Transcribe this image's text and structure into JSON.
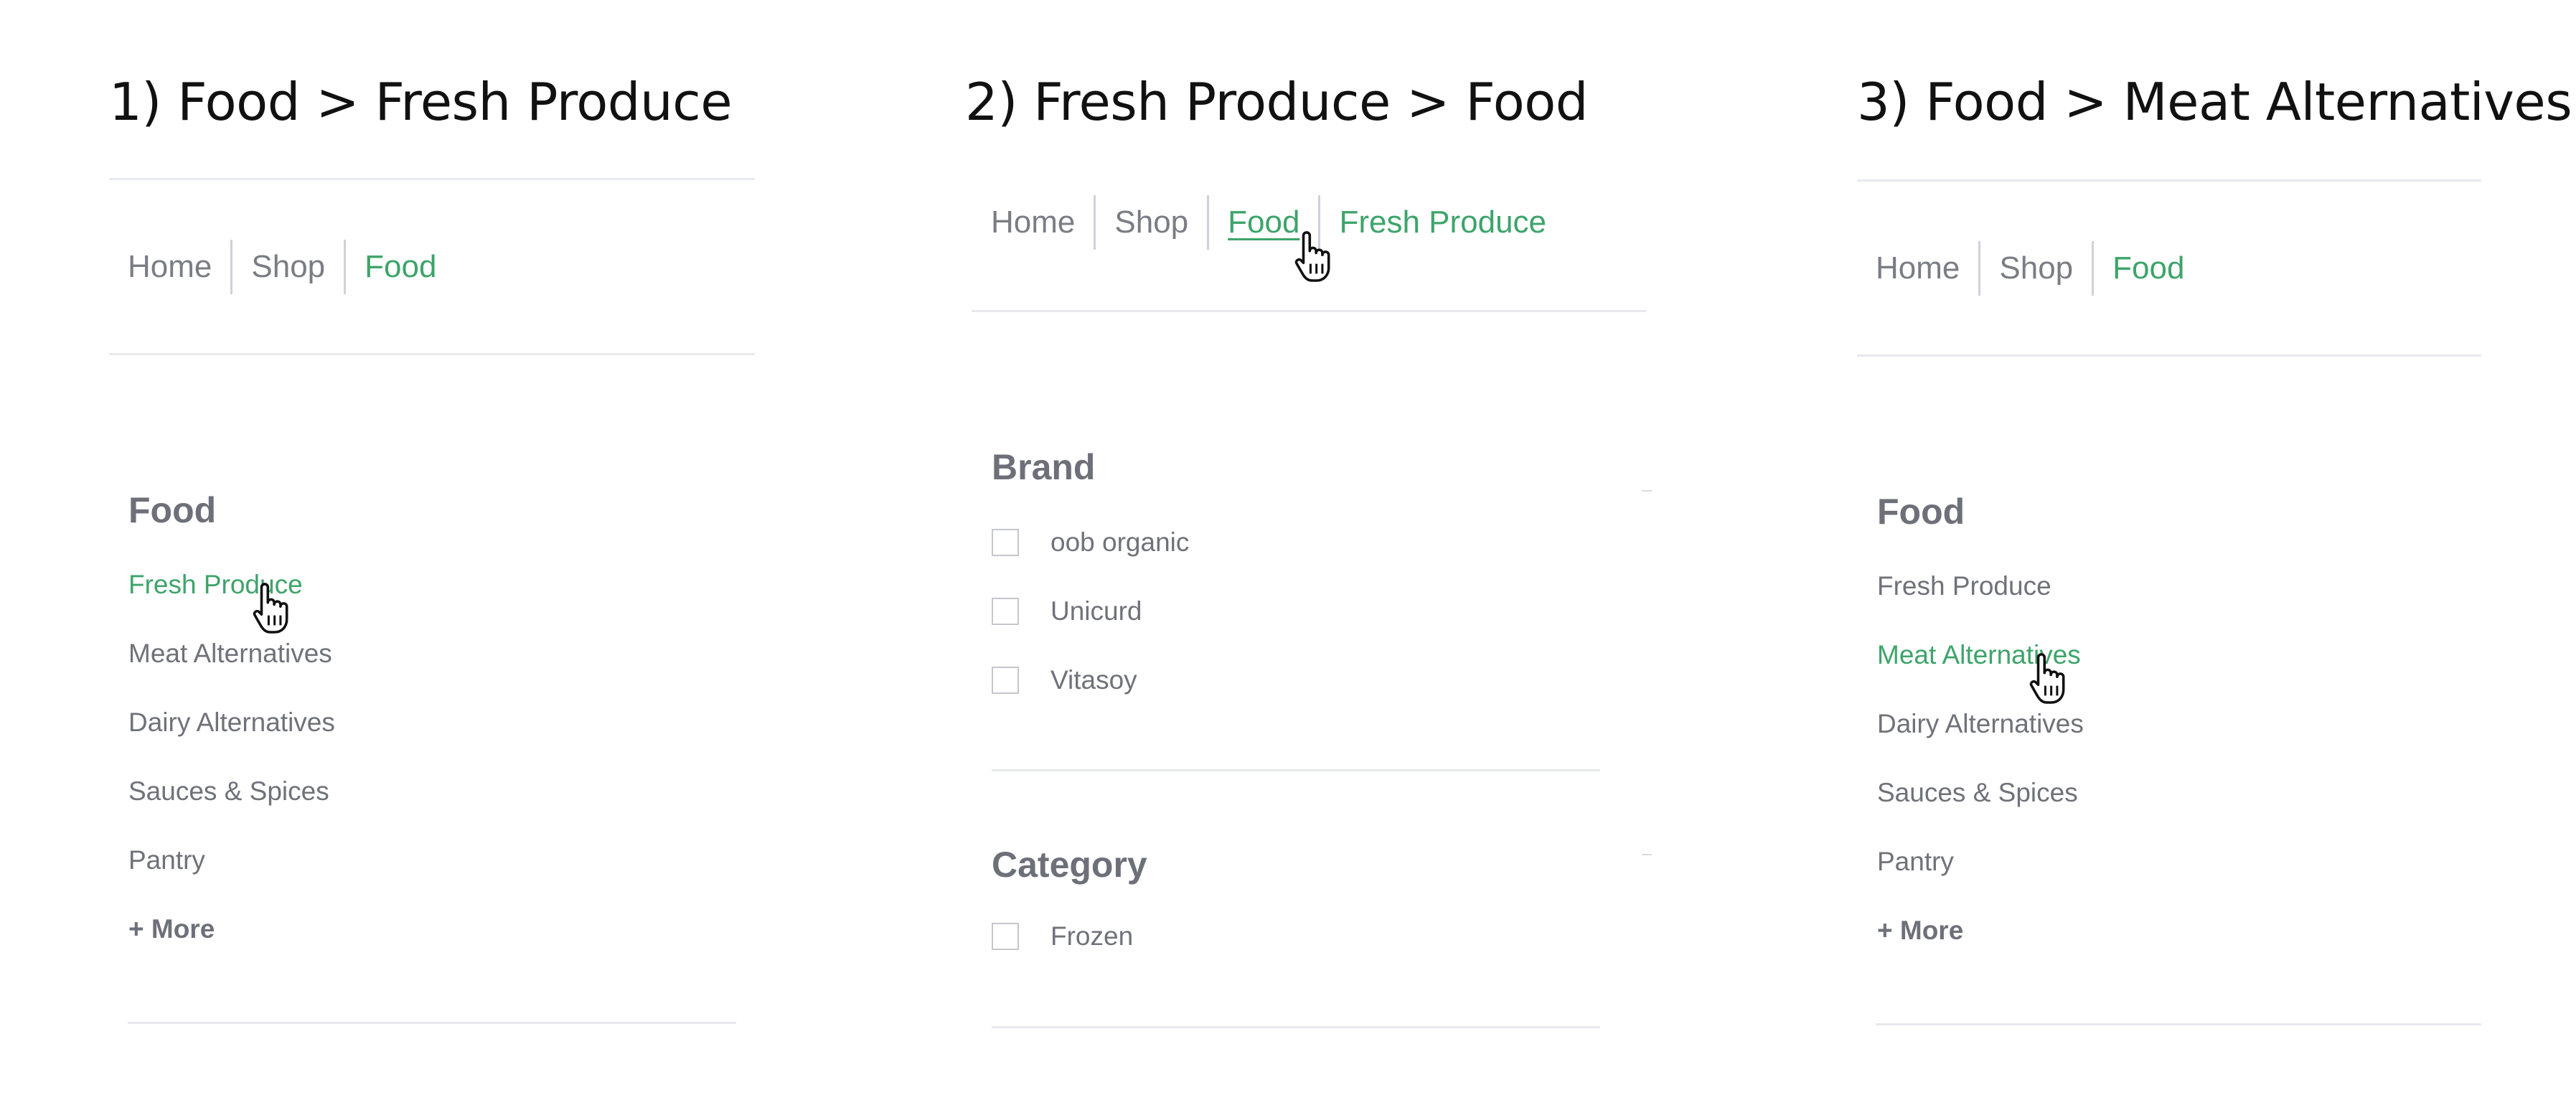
{
  "panels": [
    {
      "title": "1) Food > Fresh Produce",
      "breadcrumb": [
        "Home",
        "Shop",
        "Food"
      ],
      "sidebar_heading": "Food",
      "categories": [
        "Fresh Produce",
        "Meat Alternatives",
        "Dairy Alternatives",
        "Sauces & Spices",
        "Pantry"
      ],
      "active_category": "Fresh Produce",
      "more_label": "+ More"
    },
    {
      "title": "2) Fresh Produce > Food",
      "breadcrumb": [
        "Home",
        "Shop",
        "Food",
        "Fresh Produce"
      ],
      "hovered_breadcrumb": "Food",
      "filters": [
        {
          "heading": "Brand",
          "options": [
            "oob organic",
            "Unicurd",
            "Vitasoy"
          ]
        },
        {
          "heading": "Category",
          "options": [
            "Frozen"
          ]
        }
      ]
    },
    {
      "title": "3) Food > Meat Alternatives",
      "breadcrumb": [
        "Home",
        "Shop",
        "Food"
      ],
      "sidebar_heading": "Food",
      "categories": [
        "Fresh Produce",
        "Meat Alternatives",
        "Dairy Alternatives",
        "Sauces & Spices",
        "Pantry"
      ],
      "active_category": "Meat Alternatives",
      "more_label": "+ More"
    }
  ],
  "colors": {
    "accent_green": "#3ea46a",
    "muted_text": "#70727a",
    "heading_text": "#6e7079",
    "divider": "#e8e9ee",
    "separator": "#cfd1d8"
  },
  "icons": {
    "cursor": "hand-pointer-icon",
    "checkbox": "checkbox-unchecked-icon"
  }
}
